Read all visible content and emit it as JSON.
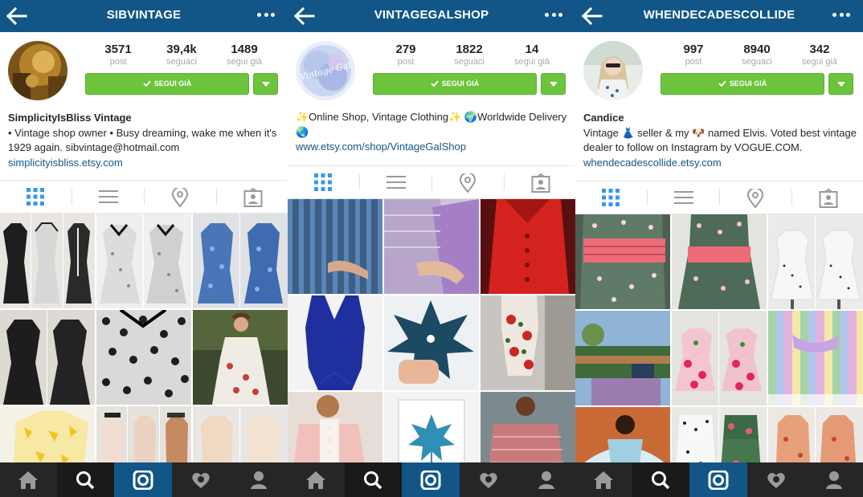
{
  "profiles": [
    {
      "username": "SIBVINTAGE",
      "stats": [
        {
          "value": "3571",
          "label": "post"
        },
        {
          "value": "39,4k",
          "label": "seguaci"
        },
        {
          "value": "1489",
          "label": "segui già"
        }
      ],
      "follow_label": "SEGUI GIÀ",
      "bio_name": "SimplicityIsBliss Vintage",
      "bio_text": "• Vintage shop owner • Busy dreaming, wake me when it's 1929 again. sibvintage@hotmail.com",
      "bio_link": "simplicityisbliss.etsy.com"
    },
    {
      "username": "VINTAGEGALSHOP",
      "stats": [
        {
          "value": "279",
          "label": "post"
        },
        {
          "value": "1822",
          "label": "seguaci"
        },
        {
          "value": "14",
          "label": "segui già"
        }
      ],
      "follow_label": "SEGUI GIÀ",
      "avatar_text": "Vintage Gal",
      "bio_name": "",
      "bio_text": "✨Online Shop, Vintage Clothing✨ 🌍Worldwide Delivery🌏",
      "bio_link": "www.etsy.com/shop/VintageGalShop"
    },
    {
      "username": "WHENDECADESCOLLIDE",
      "stats": [
        {
          "value": "997",
          "label": "post"
        },
        {
          "value": "8940",
          "label": "seguaci"
        },
        {
          "value": "342",
          "label": "segui già"
        }
      ],
      "follow_label": "SEGUI GIÀ",
      "bio_name": "Candice",
      "bio_text": "Vintage 👗 seller & my 🐶 named Elvis. Voted best vintage dealer to follow on Instagram by VOGUE.COM.",
      "bio_link": "whendecadescollide.etsy.com"
    }
  ],
  "tabs": [
    "grid-view-icon",
    "list-view-icon",
    "location-icon",
    "tagged-photos-icon"
  ],
  "bottom_nav": [
    "home-icon",
    "search-icon",
    "camera-icon",
    "activity-heart-icon",
    "profile-icon"
  ],
  "colors": {
    "header_blue": "#125688",
    "follow_green": "#6bc43c",
    "link_blue": "#125688",
    "navbar_dark": "#262626"
  }
}
